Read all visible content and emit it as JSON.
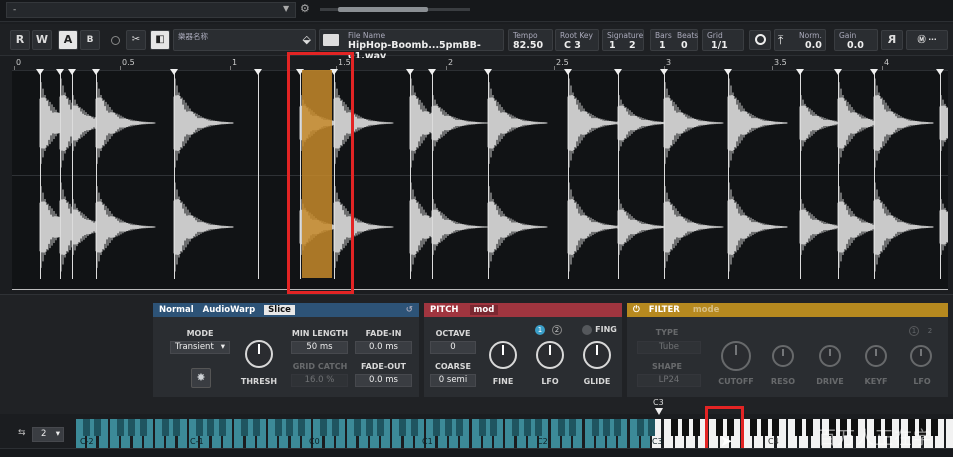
{
  "topbar": {
    "selector_value": "-",
    "arrow": "▼",
    "gear": "⚙"
  },
  "toolbar": {
    "r_label": "R",
    "w_label": "W",
    "a_label": "A",
    "b_label": "B",
    "name_field": "樂器名称",
    "file_label": "File Name",
    "file_name": "HipHop-Boomb...5pmBB-01.wav",
    "tempo_label": "Tempo",
    "tempo_value": "82.50",
    "rootkey_label": "Root Key",
    "rootkey_value": "C 3",
    "signature_label": "Signature",
    "sig_num": "1",
    "sig_den": "2",
    "bars_label": "Bars",
    "bars_value": "1",
    "beats_label": "Beats",
    "beats_value": "0",
    "grid_label": "Grid",
    "grid_value": "1/1",
    "norm_label": "Norm.",
    "norm_value": "0.0",
    "gain_label": "Gain",
    "gain_value": "0.0",
    "rev_label": "R"
  },
  "ruler": {
    "labels": [
      "0",
      "0.5",
      "1",
      "1.5",
      "2",
      "2.5",
      "3",
      "3.5",
      "4"
    ]
  },
  "audiowarp": {
    "tabs": [
      "Normal",
      "AudioWarp",
      "Slice"
    ],
    "mode_label": "MODE",
    "mode_value": "Transient",
    "thresh_label": "THRESH",
    "min_length_label": "MIN LENGTH",
    "min_length_value": "50 ms",
    "grid_catch_label": "GRID CATCH",
    "grid_catch_value": "16.0 %",
    "fade_in_label": "FADE-IN",
    "fade_in_value": "0.0 ms",
    "fade_out_label": "FADE-OUT",
    "fade_out_value": "0.0 ms"
  },
  "pitch": {
    "title": "PITCH",
    "mod_tab": "mod",
    "octave_label": "OCTAVE",
    "octave_value": "0",
    "coarse_label": "COARSE",
    "coarse_value": "0 semi",
    "fine_label": "FINE",
    "lfo_label": "LFO",
    "glide_label": "GLIDE",
    "fing_label": "FING",
    "lfo1": "1",
    "lfo2": "2"
  },
  "filter": {
    "title": "FILTER",
    "mode_tab": "mode",
    "type_label": "TYPE",
    "type_value": "Tube",
    "shape_label": "SHAPE",
    "shape_value": "LP24",
    "cutoff_label": "CUTOFF",
    "reso_label": "RESO",
    "drive_label": "DRIVE",
    "keyf_label": "KEYF",
    "lfo_label": "LFO",
    "lfo1": "1",
    "lfo2": "2"
  },
  "keyboard": {
    "octave_value": "2",
    "c3_marker": "C3",
    "labels": [
      "C-2",
      "C-1",
      "C0",
      "C1",
      "C2",
      "C3",
      "C4"
    ],
    "watermark": "百万人正在学"
  },
  "colors": {
    "highlight": "#c58a2a",
    "annotation": "#e32424",
    "audiowarp_head": "#2d5377",
    "pitch_head": "#a0353f",
    "filter_head": "#b6891f",
    "key_zone": "#2b7785"
  }
}
